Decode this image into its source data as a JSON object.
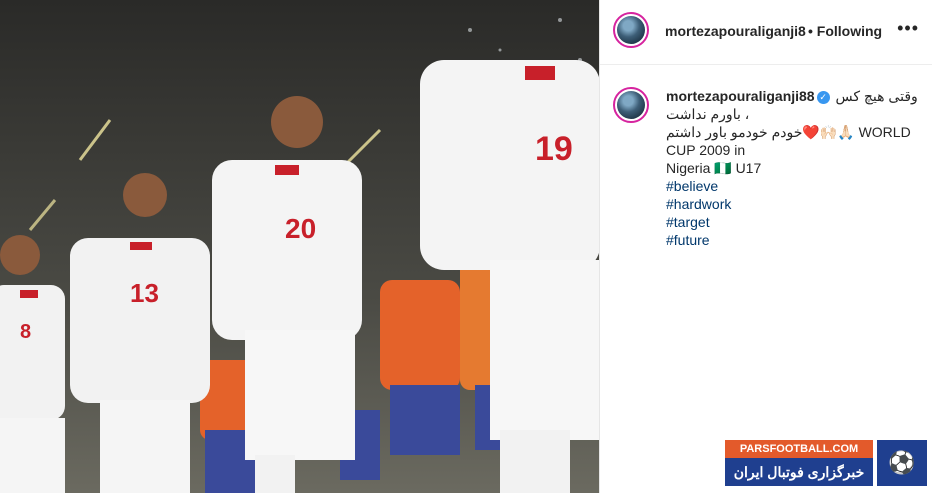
{
  "post": {
    "username": "mortezapouraliganji88",
    "header_username": "mortezapouraliganji8",
    "following_label": "• Following",
    "more_label": "•••"
  },
  "caption": {
    "line1": "وقتی هیچ کس",
    "line2": "، باورم نداشت",
    "line3": "خودم خودمو باور داشتم❤️🙌🏻🙏🏻 WORLD",
    "line4": "CUP 2009 in",
    "line5": "Nigeria 🇳🇬 U17",
    "hashtags": [
      "#believe",
      "#hardwork",
      "#target",
      "#future"
    ]
  },
  "photo": {
    "jersey_numbers": [
      "8",
      "13",
      "20",
      "19"
    ]
  },
  "watermark": {
    "top": "PARSFOOTBALL.COM",
    "bottom": "خبرگزاری فوتبال ایران"
  }
}
